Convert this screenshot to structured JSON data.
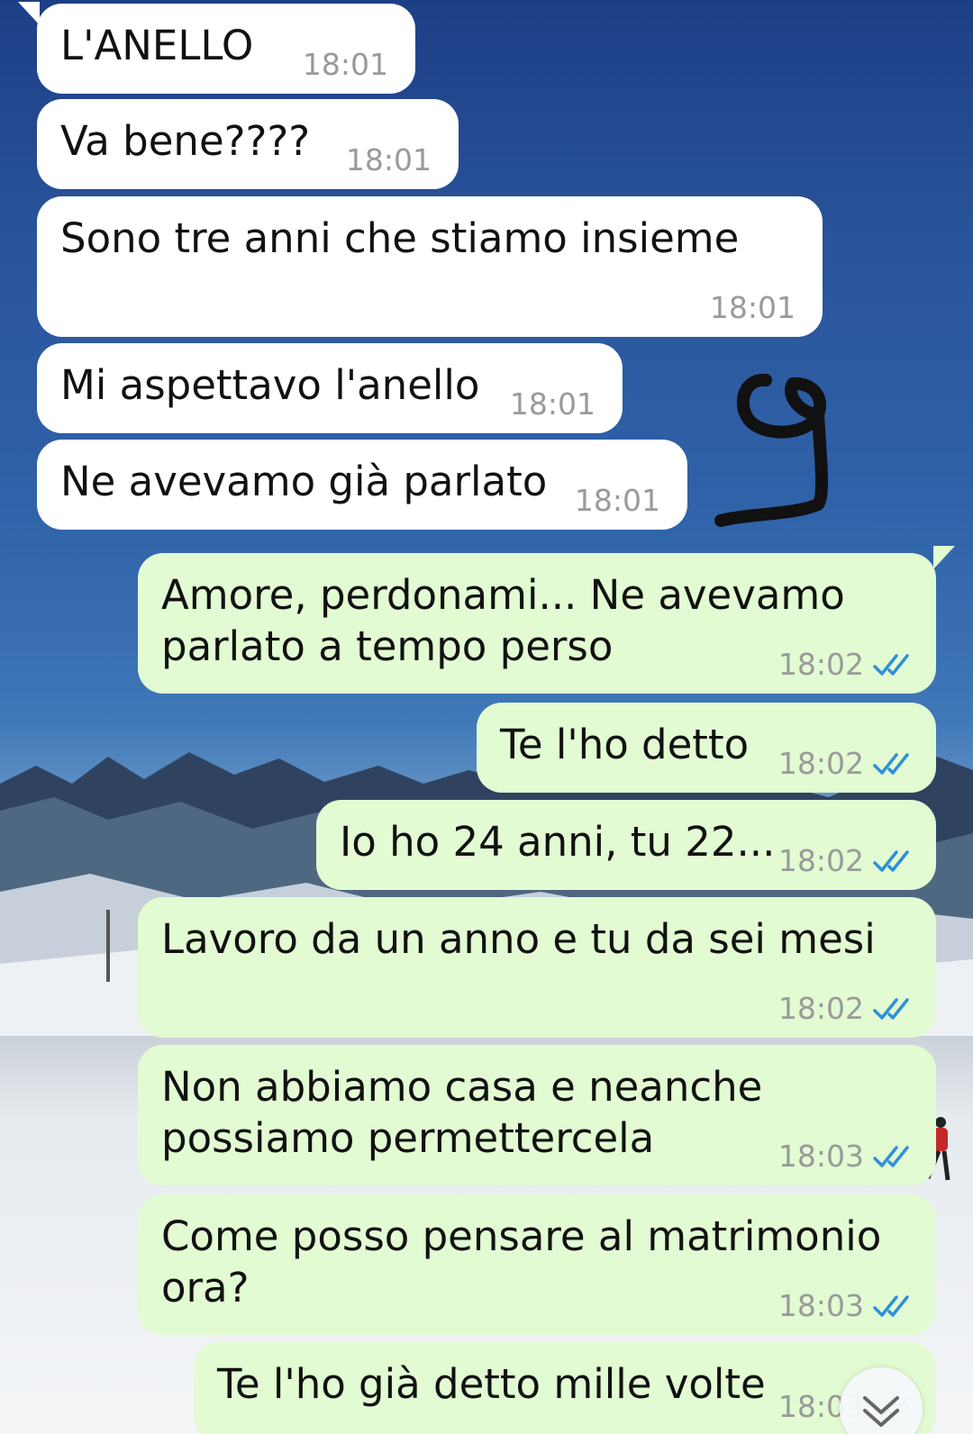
{
  "conversation": {
    "incoming": [
      {
        "text": "L'ANELLO",
        "time": "18:01"
      },
      {
        "text": "Va bene????",
        "time": "18:01"
      },
      {
        "text": "Sono tre anni che stiamo insieme",
        "time": "18:01"
      },
      {
        "text": "Mi aspettavo l'anello",
        "time": "18:01"
      },
      {
        "text": "Ne avevamo già parlato",
        "time": "18:01"
      }
    ],
    "outgoing": [
      {
        "text": "Amore, perdonami... Ne avevamo\nparlato a tempo perso",
        "time": "18:02",
        "status": "read"
      },
      {
        "text": "Te l'ho detto",
        "time": "18:02",
        "status": "read"
      },
      {
        "text": "Io ho 24 anni, tu 22...",
        "time": "18:02",
        "status": "read"
      },
      {
        "text": "Lavoro da un anno e tu da sei mesi",
        "time": "18:02",
        "status": "read"
      },
      {
        "text": "Non abbiamo casa e neanche\npossiamo permettercela",
        "time": "18:03",
        "status": "read"
      },
      {
        "text": "Come posso pensare al matrimonio\nora?",
        "time": "18:03",
        "status": "read"
      },
      {
        "text": "Te l'ho già detto mille volte",
        "time": "18:03",
        "status": "read"
      }
    ]
  },
  "colors": {
    "incoming_bubble": "#ffffff",
    "outgoing_bubble": "#e2fbd2",
    "read_ticks": "#2f8fdc",
    "timestamp": "#9a9a9a",
    "doodle": "#111111"
  },
  "icons": {
    "read_receipt": "double-check-icon",
    "scroll": "chevron-double-down-icon",
    "annotation": "hand-drawn-9-icon"
  }
}
